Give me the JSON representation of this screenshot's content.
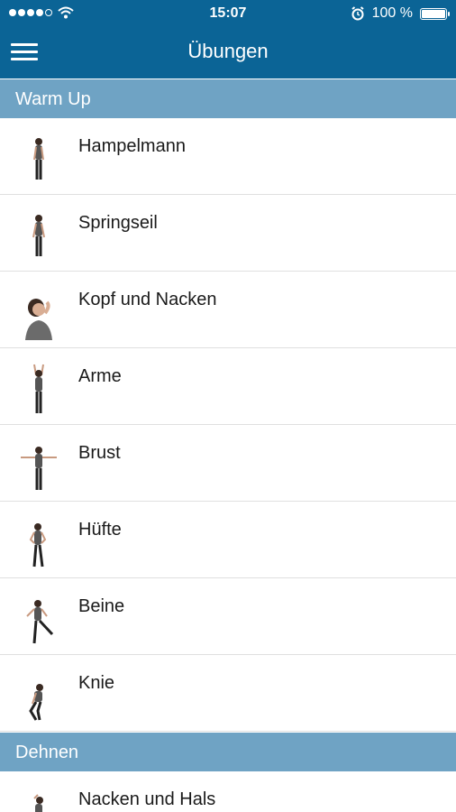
{
  "statusbar": {
    "time": "15:07",
    "battery": "100 %",
    "icons": [
      "signal-dots-icon",
      "wifi-icon",
      "alarm-icon",
      "battery-icon"
    ]
  },
  "navbar": {
    "title": "Übungen",
    "menu_icon": "hamburger-menu-icon"
  },
  "sections": [
    {
      "title": "Warm Up"
    },
    {
      "title": "Dehnen"
    }
  ],
  "warmup_items": [
    {
      "label": "Hampelmann"
    },
    {
      "label": "Springseil"
    },
    {
      "label": "Kopf und Nacken"
    },
    {
      "label": "Arme"
    },
    {
      "label": "Brust"
    },
    {
      "label": "Hüfte"
    },
    {
      "label": "Beine"
    },
    {
      "label": "Knie"
    }
  ],
  "dehnen_items": [
    {
      "label": "Nacken und Hals"
    }
  ],
  "colors": {
    "header": "#0b6496",
    "section": "#6fa3c4",
    "divider": "#e0e0e0"
  }
}
